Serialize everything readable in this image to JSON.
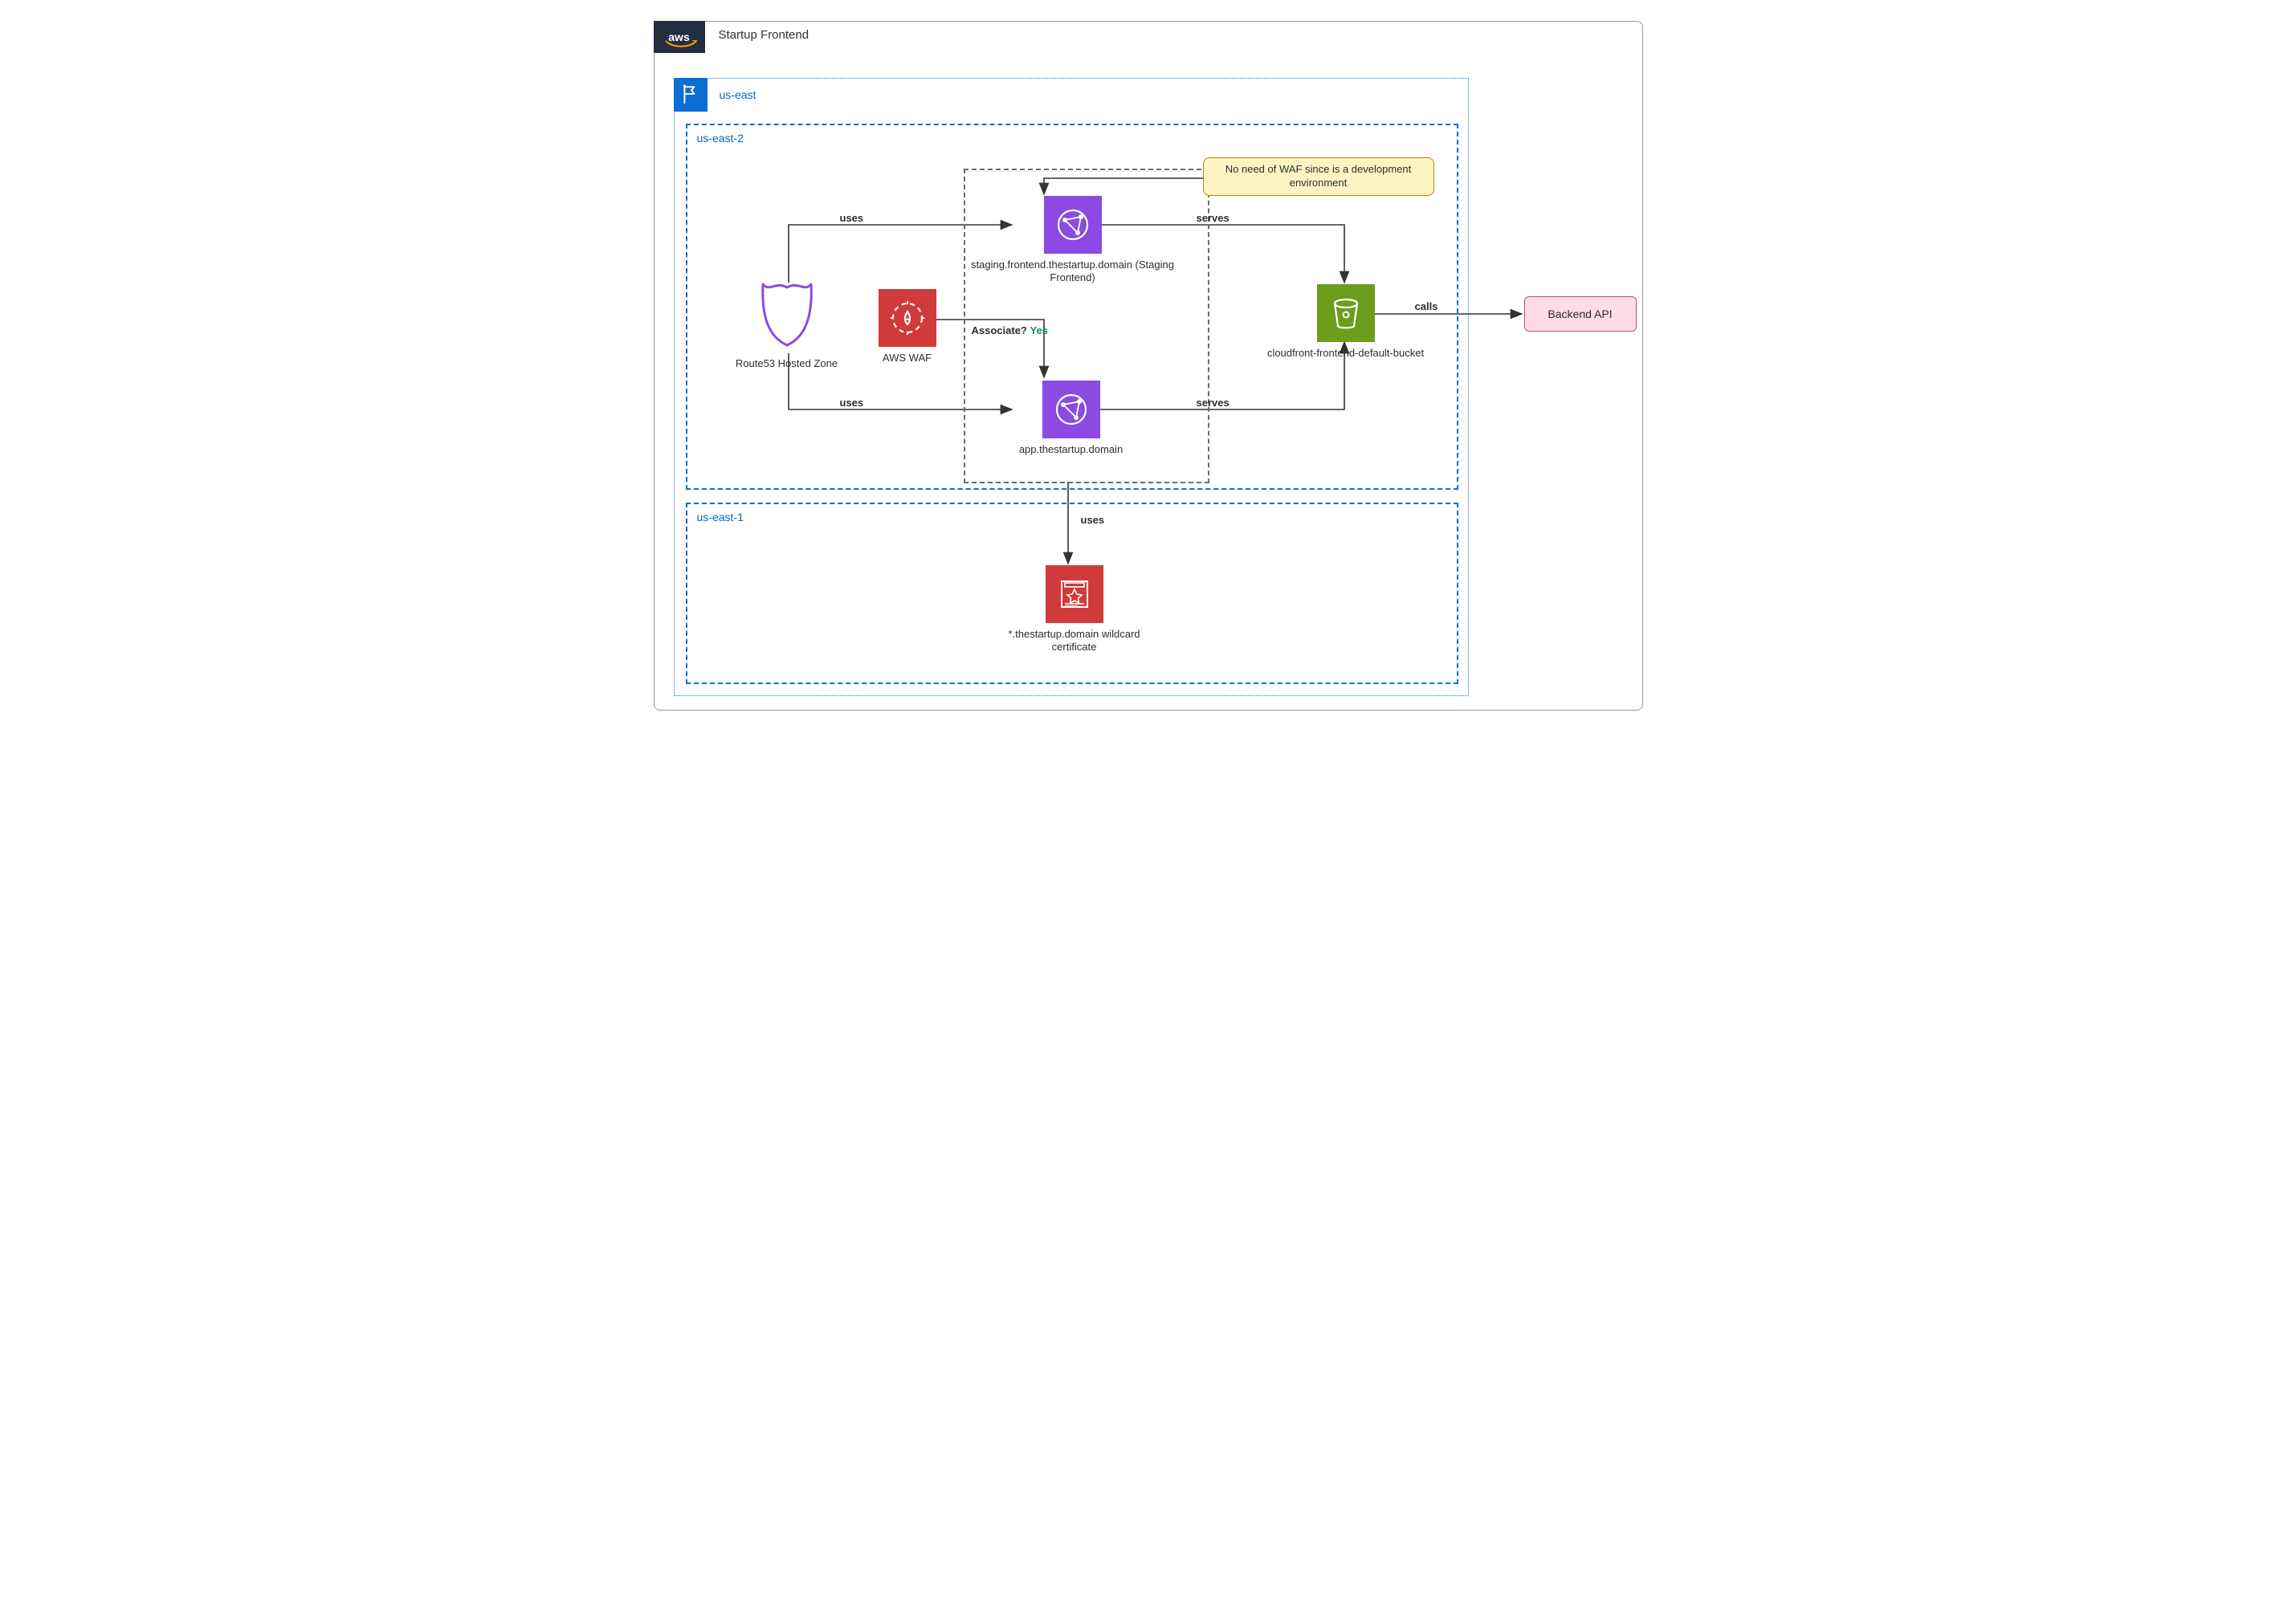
{
  "frame": {
    "title": "Startup Frontend",
    "aws_badge": "aws"
  },
  "account": {
    "label": "us-east"
  },
  "regions": {
    "useast2": {
      "label": "us-east-2"
    },
    "useast1": {
      "label": "us-east-1"
    }
  },
  "nodes": {
    "route53": {
      "label": "Route53 Hosted Zone"
    },
    "waf": {
      "label": "AWS WAF"
    },
    "staging": {
      "label": "staging.frontend.thestartup.domain (Staging Frontend)"
    },
    "app": {
      "label": "app.thestartup.domain"
    },
    "bucket": {
      "label": "cloudfront-frontend-default-bucket"
    },
    "cert": {
      "label": "*.thestartup.domain wildcard certificate"
    },
    "backend": {
      "label": "Backend API"
    }
  },
  "edges": {
    "uses_top": "uses",
    "uses_bottom": "uses",
    "serves_top": "serves",
    "serves_bottom": "serves",
    "calls": "calls",
    "uses_cert": "uses",
    "associate_label": "Associate? ",
    "associate_yes": "Yes"
  },
  "note": {
    "text_line1": "No need of WAF since is a development",
    "text_line2": "environment"
  },
  "icon_names": {
    "route53": "shield-icon",
    "waf": "firewall-icon",
    "cloudfront": "globe-network-icon",
    "bucket": "bucket-icon",
    "cert": "certificate-icon",
    "flag": "flag-icon"
  }
}
